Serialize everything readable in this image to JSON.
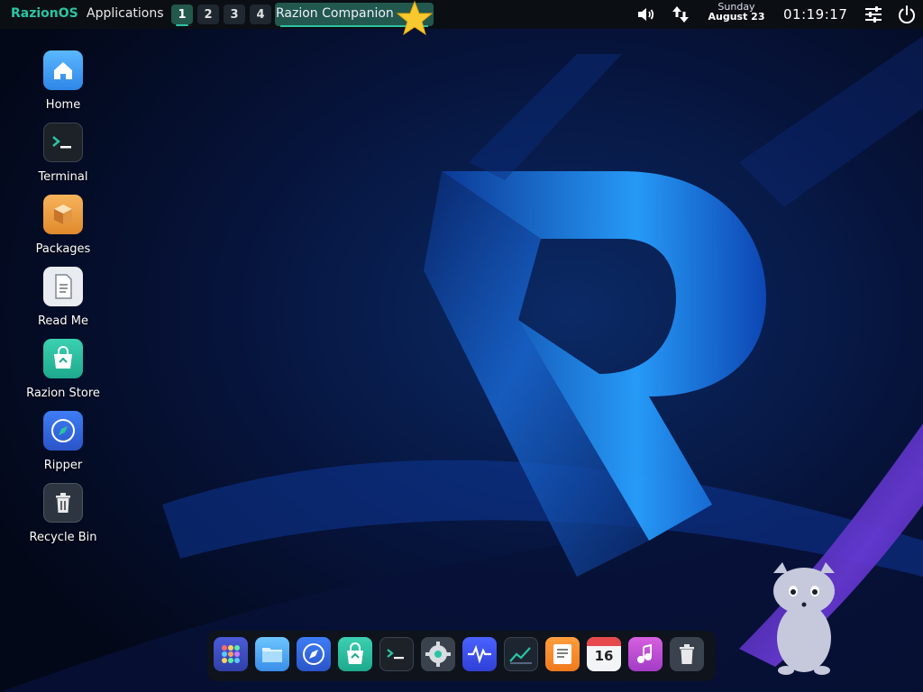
{
  "topbar": {
    "brand": "RazionOS",
    "applications_label": "Applications",
    "workspaces": [
      "1",
      "2",
      "3",
      "4"
    ],
    "active_workspace": "1",
    "task_label": "Razion Companion",
    "date_day": "Sunday",
    "date_full": "August 23",
    "clock": "01:19:17",
    "tray_icons": [
      "volume-icon",
      "network-icon",
      "settings-sliders-icon",
      "power-icon"
    ]
  },
  "desktop": {
    "icons": [
      {
        "label": "Home",
        "icon": "home-icon"
      },
      {
        "label": "Terminal",
        "icon": "terminal-icon"
      },
      {
        "label": "Packages",
        "icon": "package-icon"
      },
      {
        "label": "Read Me",
        "icon": "document-icon"
      },
      {
        "label": "Razion Store",
        "icon": "store-icon"
      },
      {
        "label": "Ripper",
        "icon": "compass-icon"
      },
      {
        "label": "Recycle Bin",
        "icon": "trash-icon"
      }
    ]
  },
  "dock": {
    "items": [
      "app-grid-icon",
      "files-icon",
      "browser-icon",
      "store-icon",
      "terminal-icon",
      "settings-icon",
      "system-monitor-icon",
      "stats-icon",
      "notes-icon",
      "calendar-icon",
      "music-icon",
      "trash-icon"
    ],
    "calendar_day": "16"
  },
  "colors": {
    "accent": "#2bc3a3",
    "panel": "#0b0f14",
    "background": "#040a1c"
  }
}
